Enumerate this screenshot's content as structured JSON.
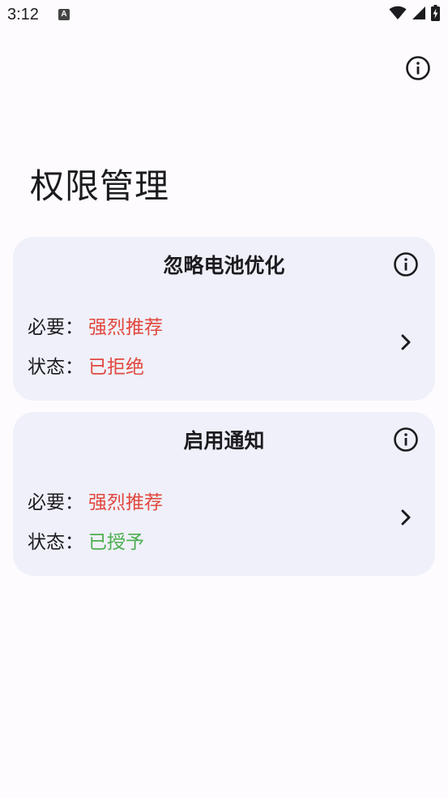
{
  "status_bar": {
    "time": "3:12",
    "app_icon_letter": "A",
    "icons": [
      "wifi-icon",
      "signal-icon",
      "battery-charging-icon"
    ]
  },
  "header": {
    "info_icon": "info-icon"
  },
  "page": {
    "title": "权限管理"
  },
  "cards": [
    {
      "title": "忽略电池优化",
      "required_label": "必要：",
      "required_value": "强烈推荐",
      "required_color": "#e2483f",
      "status_label": "状态：",
      "status_value": "已拒绝",
      "status_color": "#e2483f"
    },
    {
      "title": "启用通知",
      "required_label": "必要：",
      "required_value": "强烈推荐",
      "required_color": "#e2483f",
      "status_label": "状态：",
      "status_value": "已授予",
      "status_color": "#4caf50"
    }
  ],
  "colors": {
    "background": "#fdfbfe",
    "card_background": "#eff0f9",
    "text": "#1c1b1f",
    "danger": "#e2483f",
    "success": "#4caf50"
  }
}
